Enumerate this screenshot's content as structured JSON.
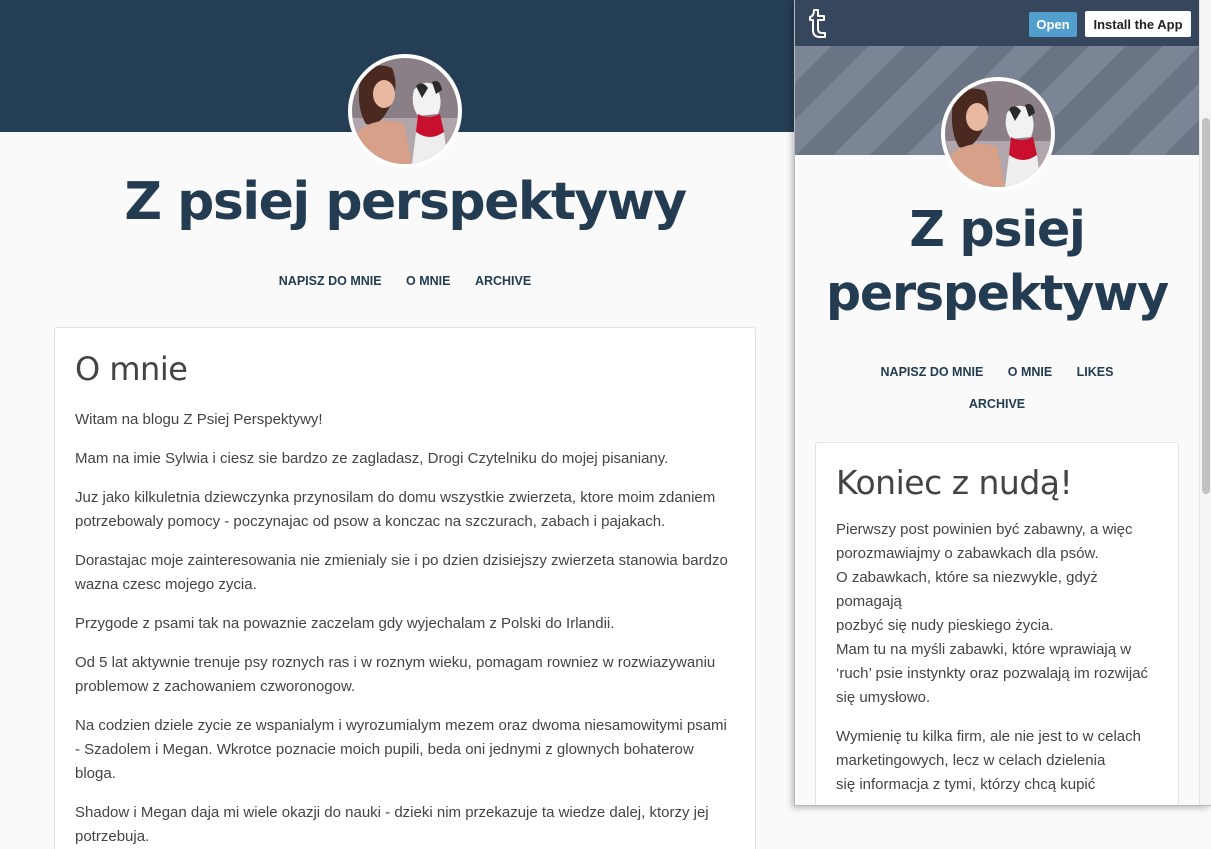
{
  "blog": {
    "title": "Z psiej perspektywy",
    "title_line1": "Z psiej",
    "title_line2": "perspektywy"
  },
  "nav": {
    "write": "NAPISZ DO MNIE",
    "about": "O MNIE",
    "likes": "LIKES",
    "archive": "ARCHIVE"
  },
  "post": {
    "title": "O mnie",
    "paragraphs": [
      "Witam na blogu Z Psiej Perspektywy!",
      "Mam na imie Sylwia i ciesz sie bardzo ze zagladasz, Drogi Czytelniku do mojej pisaniany.",
      "Juz jako kilkuletnia dziewczynka przynosilam do domu wszystkie zwierzeta, ktore moim zdaniem potrzebowaly pomocy - poczynajac od psow a konczac na szczurach, zabach i pajakach.",
      "Dorastajac moje zainteresowania nie zmienialy sie i po dzien dzisiejszy zwierzeta stanowia bardzo wazna czesc mojego zycia.",
      "Przygode z psami tak na powaznie zaczelam gdy wyjechalam z Polski do Irlandii.",
      "Od 5 lat aktywnie trenuje psy roznych ras i w roznym wieku, pomagam rowniez w rozwiazywaniu problemow z zachowaniem czworonogow.",
      "Na codzien dziele zycie ze wspanialym i wyrozumialym mezem oraz dwoma niesamowitymi psami - Szadolem i Megan. Wkrotce poznacie moich pupili, beda oni jednymi z glownych bohaterow bloga.",
      "Shadow i Megan daja mi wiele okazji do nauki - dzieki nim przekazuje ta wiedze dalej, ktorzy jej potrzebuja."
    ]
  },
  "preview": {
    "open_label": "Open",
    "install_label": "Install the App",
    "post_title": "Koniec z nudą!",
    "paragraph1_lines": [
      "Pierwszy post powinien być zabawny, a więc",
      "porozmawiajmy o zabawkach dla psów.",
      "O zabawkach, które sa niezwykle, gdyż",
      "pomagają",
      "pozbyć się nudy pieskiego życia.",
      "Mam tu na myśli zabawki, które wprawiają w",
      "‘ruch’ psie instynkty oraz pozwalają im rozwijać",
      "się umysłowo."
    ],
    "paragraph2_lines": [
      "Wymienię tu kilka firm, ale nie jest to w celach",
      "marketingowych, lecz w celach dzielenia",
      "się informacja z tymi, którzy chcą kupić"
    ]
  },
  "icons": {
    "app_logo": "tumblr-t-icon",
    "avatar": "avatar-woman-with-dog"
  },
  "colors": {
    "header_bg": "#243e55",
    "title": "#233c52",
    "open_button": "#529ecc",
    "preview_bar": "#36465d"
  }
}
